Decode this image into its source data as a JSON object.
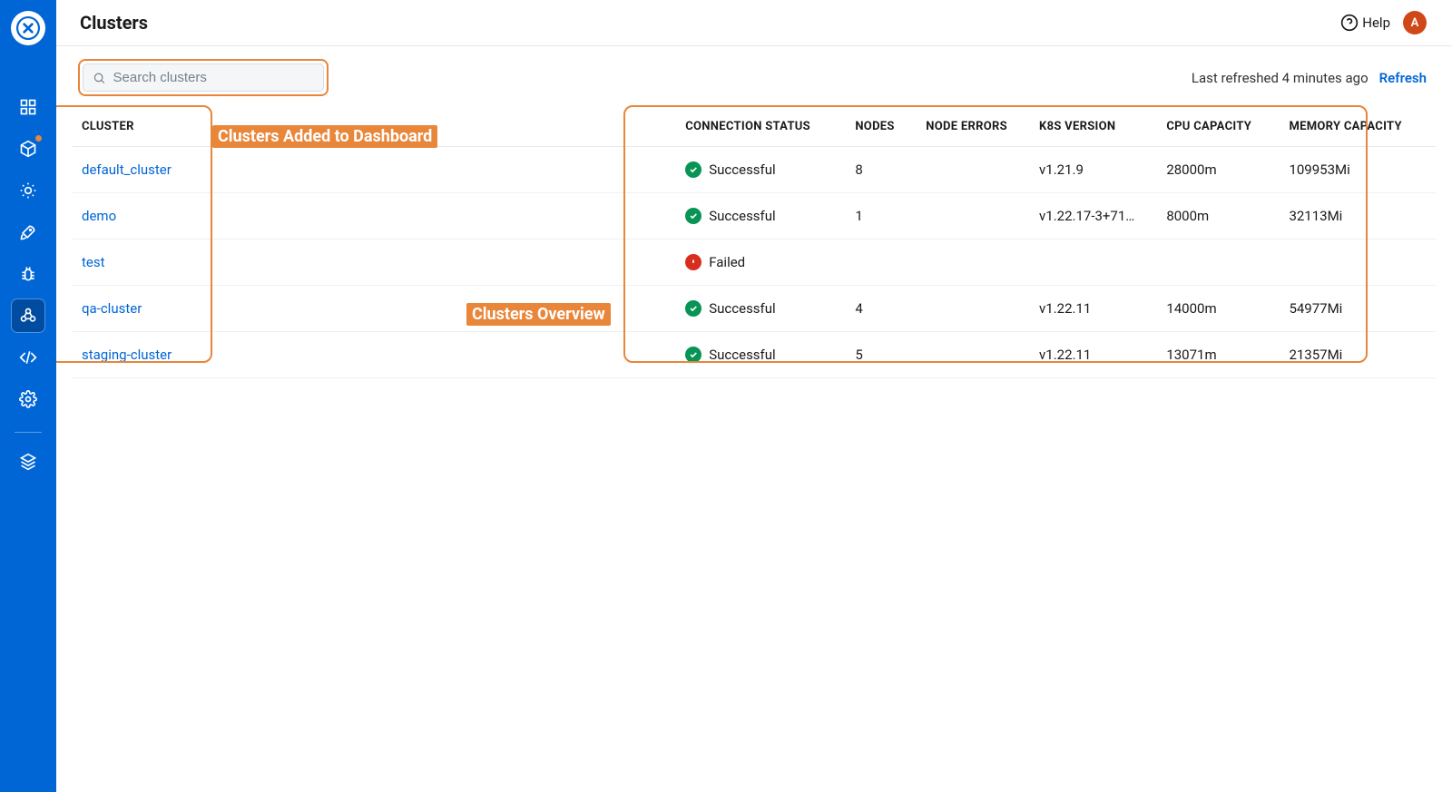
{
  "header": {
    "title": "Clusters",
    "help_label": "Help",
    "avatar_initial": "A"
  },
  "toolbar": {
    "search_placeholder": "Search clusters",
    "last_refreshed": "Last refreshed 4 minutes ago",
    "refresh_label": "Refresh"
  },
  "table": {
    "headers": {
      "cluster": "CLUSTER",
      "connection_status": "CONNECTION STATUS",
      "nodes": "NODES",
      "node_errors": "NODE ERRORS",
      "k8s_version": "K8S VERSION",
      "cpu_capacity": "CPU CAPACITY",
      "memory_capacity": "MEMORY CAPACITY"
    },
    "rows": [
      {
        "name": "default_cluster",
        "status": "Successful",
        "status_kind": "success",
        "nodes": "8",
        "node_errors": "",
        "k8s": "v1.21.9",
        "cpu": "28000m",
        "memory": "109953Mi"
      },
      {
        "name": "demo",
        "status": "Successful",
        "status_kind": "success",
        "nodes": "1",
        "node_errors": "",
        "k8s": "v1.22.17-3+71…",
        "cpu": "8000m",
        "memory": "32113Mi"
      },
      {
        "name": "test",
        "status": "Failed",
        "status_kind": "failed",
        "nodes": "",
        "node_errors": "",
        "k8s": "",
        "cpu": "",
        "memory": ""
      },
      {
        "name": "qa-cluster",
        "status": "Successful",
        "status_kind": "success",
        "nodes": "4",
        "node_errors": "",
        "k8s": "v1.22.11",
        "cpu": "14000m",
        "memory": "54977Mi"
      },
      {
        "name": "staging-cluster",
        "status": "Successful",
        "status_kind": "success",
        "nodes": "5",
        "node_errors": "",
        "k8s": "v1.22.11",
        "cpu": "13071m",
        "memory": "21357Mi"
      }
    ]
  },
  "annotations": {
    "clusters_added": "Clusters Added to Dashboard",
    "clusters_overview": "Clusters Overview"
  },
  "sidebar": {
    "items": [
      {
        "name": "dashboard",
        "active": false,
        "badge": false
      },
      {
        "name": "packages",
        "active": false,
        "badge": true
      },
      {
        "name": "settings-sun",
        "active": false,
        "badge": false
      },
      {
        "name": "rocket",
        "active": false,
        "badge": false
      },
      {
        "name": "bug",
        "active": false,
        "badge": false
      },
      {
        "name": "clusters",
        "active": true,
        "badge": false
      },
      {
        "name": "code",
        "active": false,
        "badge": false
      },
      {
        "name": "gear",
        "active": false,
        "badge": false
      },
      {
        "name": "stack",
        "active": false,
        "badge": false
      }
    ]
  }
}
